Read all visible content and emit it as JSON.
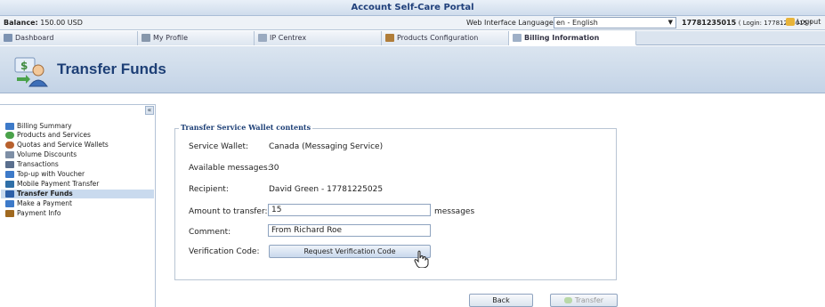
{
  "window": {
    "title": "Account Self-Care Portal"
  },
  "info": {
    "balance_label": "Balance:",
    "balance_value": "150.00 USD",
    "language_label": "Web Interface Language:",
    "language_value": "en - English",
    "account_number": "17781235015",
    "account_login": "( Login: 17781235015 )",
    "logout": "Logout"
  },
  "tabs": [
    {
      "label": "Dashboard",
      "icon": "dashboard-icon"
    },
    {
      "label": "My Profile",
      "icon": "profile-icon"
    },
    {
      "label": "IP Centrex",
      "icon": "ip-centrex-icon"
    },
    {
      "label": "Products Configuration",
      "icon": "products-config-icon"
    },
    {
      "label": "Billing Information",
      "icon": "billing-icon"
    }
  ],
  "header": {
    "title": "Transfer Funds",
    "icon": "transfer-funds-icon"
  },
  "sidebar": {
    "collapse": "«",
    "items": [
      {
        "label": "Billing Summary",
        "icon": "billing-summary-icon",
        "color": "#3d7ac9"
      },
      {
        "label": "Products and Services",
        "icon": "products-icon",
        "color": "#4aa24a"
      },
      {
        "label": "Quotas and Service Wallets",
        "icon": "quotas-icon",
        "color": "#b8612e"
      },
      {
        "label": "Volume Discounts",
        "icon": "discount-icon",
        "color": "#7e8fa6"
      },
      {
        "label": "Transactions",
        "icon": "transactions-icon",
        "color": "#5a6f8e"
      },
      {
        "label": "Top-up with Voucher",
        "icon": "voucher-icon",
        "color": "#3d7ac9"
      },
      {
        "label": "Mobile Payment Transfer",
        "icon": "mobile-payment-icon",
        "color": "#2f6fa8"
      },
      {
        "label": "Transfer Funds",
        "icon": "transfer-icon",
        "color": "#2c5fa8"
      },
      {
        "label": "Make a Payment",
        "icon": "payment-icon",
        "color": "#3d7ac9"
      },
      {
        "label": "Payment Info",
        "icon": "payment-info-icon",
        "color": "#a0691f"
      }
    ]
  },
  "form": {
    "legend": "Transfer Service Wallet contents",
    "service_wallet_label": "Service Wallet:",
    "service_wallet_value": "Canada (Messaging Service)",
    "available_label": "Available messages:",
    "available_value": "30",
    "recipient_label": "Recipient:",
    "recipient_value": "David Green - 17781225025",
    "amount_label": "Amount to transfer:",
    "amount_value": "15",
    "amount_unit": "messages",
    "comment_label": "Comment:",
    "comment_value": "From Richard Roe",
    "verification_label": "Verification Code:",
    "verification_button": "Request Verification Code"
  },
  "actions": {
    "back": "Back",
    "transfer": "Transfer"
  }
}
